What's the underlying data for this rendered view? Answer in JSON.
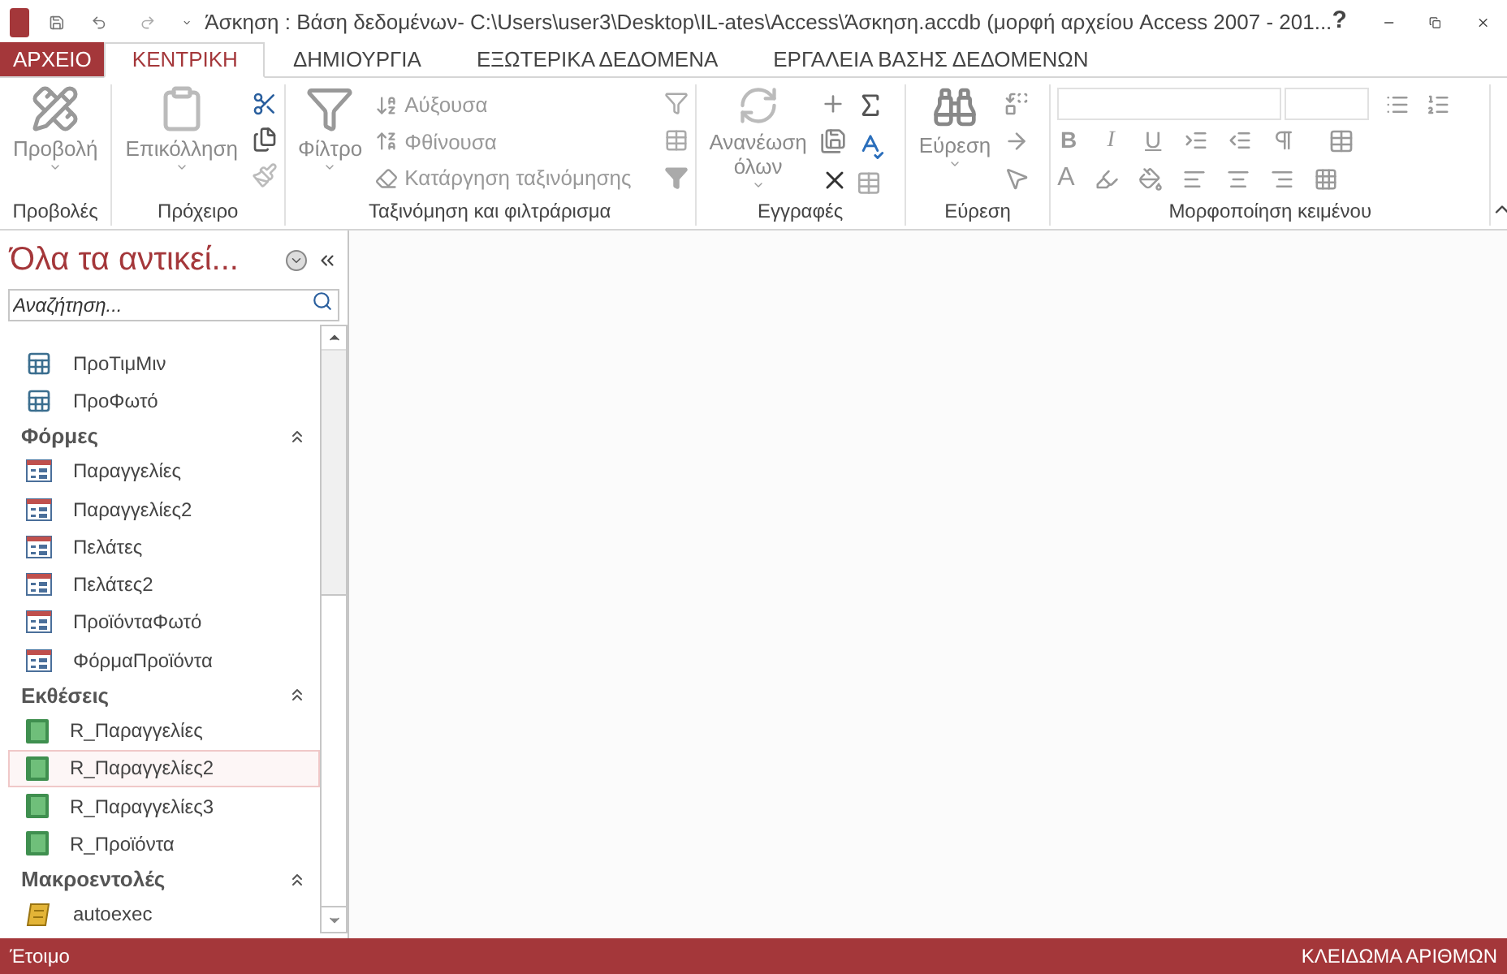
{
  "title_bar": {
    "title": "Άσκηση : Βάση δεδομένων- C:\\Users\\user3\\Desktop\\IL-ates\\Access\\Άσκηση.accdb (μορφή αρχείου Access 2007 - 201...",
    "help": "?"
  },
  "tabs": [
    {
      "label": "ΑΡΧΕΙΟ",
      "kind": "file",
      "selected": false
    },
    {
      "label": "ΚΕΝΤΡΙΚΗ",
      "kind": "tab",
      "selected": true
    },
    {
      "label": "ΔΗΜΙΟΥΡΓΙΑ",
      "kind": "tab",
      "selected": false
    },
    {
      "label": "ΕΞΩΤΕΡΙΚΑ ΔΕΔΟΜΕΝΑ",
      "kind": "tab",
      "selected": false
    },
    {
      "label": "ΕΡΓΑΛΕΙΑ ΒΑΣΗΣ ΔΕΔΟΜΕΝΩΝ",
      "kind": "tab",
      "selected": false
    }
  ],
  "ribbon": {
    "groups": [
      {
        "label": "Προβολές",
        "large": {
          "label": "Προβολή",
          "disabled": true
        }
      },
      {
        "label": "Πρόχειρο",
        "large": {
          "label": "Επικόλληση",
          "disabled": true
        }
      },
      {
        "label": "Ταξινόμηση και φιλτράρισμα",
        "large": {
          "label": "Φίλτρο",
          "disabled": true
        },
        "small": [
          {
            "label": "Αύξουσα",
            "disabled": true
          },
          {
            "label": "Φθίνουσα",
            "disabled": true
          },
          {
            "label": "Κατάργηση ταξινόμησης",
            "disabled": true
          }
        ]
      },
      {
        "label": "Εγγραφές",
        "large": {
          "label": "Ανανέωση όλων",
          "disabled": true
        }
      },
      {
        "label": "Εύρεση",
        "large": {
          "label": "Εύρεση",
          "disabled": true
        }
      },
      {
        "label": "Μορφοποίηση κειμένου",
        "format_buttons": [
          "B",
          "I",
          "U"
        ],
        "font_color_button": "A"
      }
    ]
  },
  "nav_pane": {
    "title": "Όλα τα αντικεί...",
    "search": {
      "placeholder": "Αναζήτηση..."
    },
    "sections": [
      {
        "kind": "query",
        "items": [
          {
            "label": "ΠροΤιμΜιν",
            "hovered": false
          },
          {
            "label": "ΠροΦωτό",
            "hovered": false
          }
        ]
      },
      {
        "kind": "form",
        "header": "Φόρμες",
        "items": [
          {
            "label": "Παραγγελίες",
            "hovered": false
          },
          {
            "label": "Παραγγελίες2",
            "hovered": false
          },
          {
            "label": "Πελάτες",
            "hovered": false
          },
          {
            "label": "Πελάτες2",
            "hovered": false
          },
          {
            "label": "ΠροϊόνταΦωτό",
            "hovered": false
          },
          {
            "label": "ΦόρμαΠροϊόντα",
            "hovered": false
          }
        ]
      },
      {
        "kind": "report",
        "header": "Εκθέσεις",
        "items": [
          {
            "label": "R_Παραγγελίες",
            "hovered": false
          },
          {
            "label": "R_Παραγγελίες2",
            "hovered": true
          },
          {
            "label": "R_Παραγγελίες3",
            "hovered": false
          },
          {
            "label": "R_Προϊόντα",
            "hovered": false
          }
        ]
      },
      {
        "kind": "macro",
        "header": "Μακροεντολές",
        "items": [
          {
            "label": "autoexec",
            "hovered": false
          }
        ]
      }
    ]
  },
  "status_bar": {
    "left": "Έτοιμο",
    "right": "ΚΛΕΙΔΩΜΑ ΑΡΙΘΜΩΝ"
  }
}
